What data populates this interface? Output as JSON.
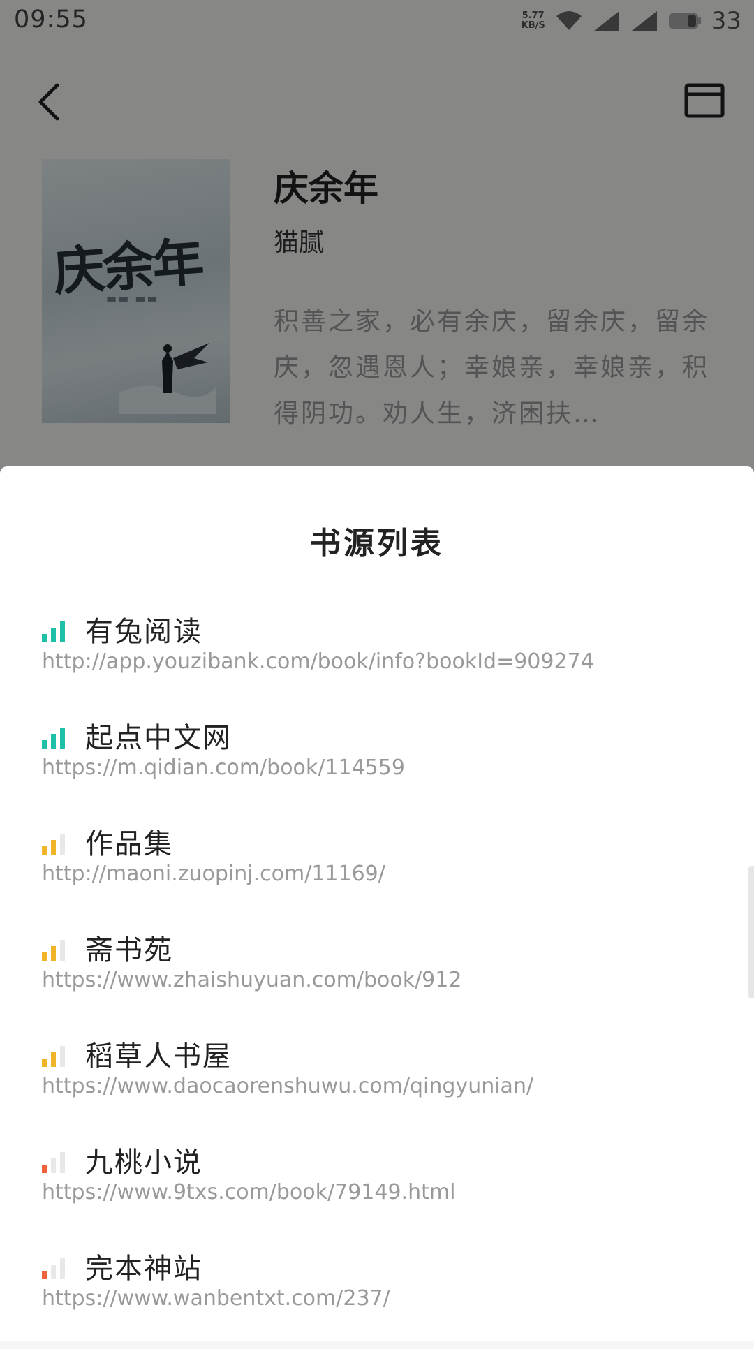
{
  "status_bar": {
    "time": "09:55",
    "net_speed_value": "5.77",
    "net_speed_unit": "KB/S",
    "battery_level": "33"
  },
  "header": {
    "back_icon": "chevron-left-icon",
    "window_icon": "browser-window-icon"
  },
  "book": {
    "cover_title": "庆余年",
    "title": "庆余年",
    "author": "猫腻",
    "description": "积善之家，必有余庆，留余庆，留余庆，忽遇恩人；幸娘亲，幸娘亲，积得阴功。劝人生，济困扶…"
  },
  "sheet": {
    "title": "书源列表",
    "sources": [
      {
        "name": "有兔阅读",
        "url": "http://app.youzibank.com/book/info?bookId=909274",
        "signal": 3,
        "color": "#1fc0a8"
      },
      {
        "name": "起点中文网",
        "url": "https://m.qidian.com/book/114559",
        "signal": 3,
        "color": "#1fc0a8"
      },
      {
        "name": "作品集",
        "url": "http://maoni.zuopinj.com/11169/",
        "signal": 2,
        "color": "#f0b429"
      },
      {
        "name": "斋书苑",
        "url": "https://www.zhaishuyuan.com/book/912",
        "signal": 2,
        "color": "#f0b429"
      },
      {
        "name": "稻草人书屋",
        "url": "https://www.daocaorenshuwu.com/qingyunian/",
        "signal": 2,
        "color": "#f0b429"
      },
      {
        "name": "九桃小说",
        "url": "https://www.9txs.com/book/79149.html",
        "signal": 1,
        "color": "#f0623a"
      },
      {
        "name": "完本神站",
        "url": "https://www.wanbentxt.com/237/",
        "signal": 1,
        "color": "#f0623a"
      }
    ]
  }
}
